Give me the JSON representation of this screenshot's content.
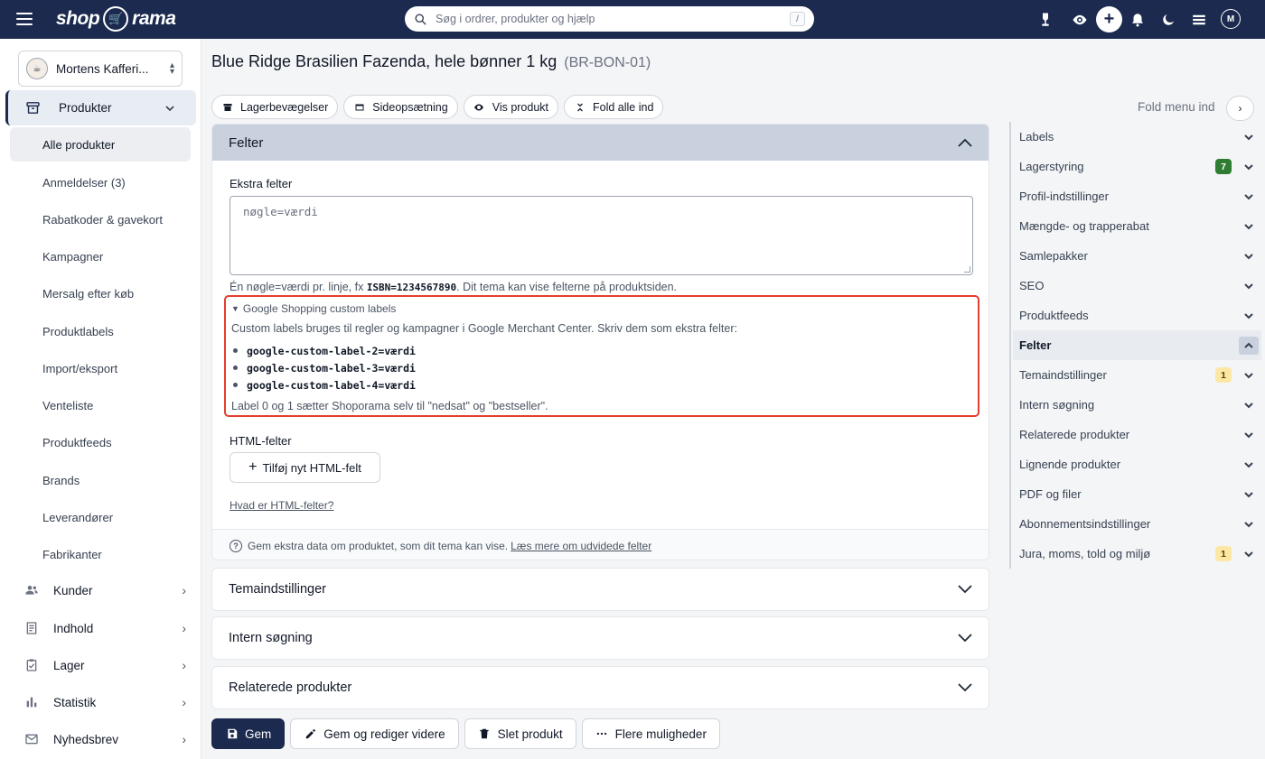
{
  "topbar": {
    "logo_left": "shop",
    "logo_right": "rama",
    "search_placeholder": "Søg i ordrer, produkter og hjælp",
    "search_shortcut": "/",
    "avatar_initial": "M"
  },
  "sidebar": {
    "shop_name": "Mortens Kafferi...",
    "products_label": "Produkter",
    "sub_items": [
      {
        "label": "Alle produkter"
      },
      {
        "label": "Anmeldelser (3)"
      },
      {
        "label": "Rabatkoder & gavekort"
      },
      {
        "label": "Kampagner"
      },
      {
        "label": "Mersalg efter køb"
      },
      {
        "label": "Produktlabels"
      },
      {
        "label": "Import/eksport"
      },
      {
        "label": "Venteliste"
      },
      {
        "label": "Produktfeeds"
      },
      {
        "label": "Brands"
      },
      {
        "label": "Leverandører"
      },
      {
        "label": "Fabrikanter"
      }
    ],
    "main_items": [
      {
        "label": "Kunder",
        "icon": "users-icon"
      },
      {
        "label": "Indhold",
        "icon": "document-icon"
      },
      {
        "label": "Lager",
        "icon": "clipboard-check-icon"
      },
      {
        "label": "Statistik",
        "icon": "bar-chart-icon"
      },
      {
        "label": "Nyhedsbrev",
        "icon": "mail-icon"
      }
    ]
  },
  "page": {
    "title": "Blue Ridge Brasilien Fazenda, hele bønner 1 kg",
    "sku": "(BR-BON-01)"
  },
  "actions": {
    "stock_moves": "Lagerbevægelser",
    "page_setup": "Sideopsætning",
    "view_product": "Vis produkt",
    "fold_all": "Fold alle ind"
  },
  "felter": {
    "title": "Felter",
    "extra_label": "Ekstra felter",
    "extra_placeholder": "nøgle=værdi",
    "help_pre": "Én nøgle=værdi pr. linje, fx ",
    "help_code": "ISBN=1234567890",
    "help_post": ". Dit tema kan vise felterne på produktsiden.",
    "gs_summary": "Google Shopping custom labels",
    "gs_desc": "Custom labels bruges til regler og kampagner i Google Merchant Center. Skriv dem som ekstra felter:",
    "gs_items": [
      "google-custom-label-2=værdi",
      "google-custom-label-3=værdi",
      "google-custom-label-4=værdi"
    ],
    "gs_note": "Label 0 og 1 sætter Shoporama selv til \"nedsat\" og \"bestseller\".",
    "html_label": "HTML-felter",
    "add_html": "Tilføj nyt HTML-felt",
    "what_html": "Hvad er HTML-felter?",
    "footer_text": "Gem ekstra data om produktet, som dit tema kan vise.",
    "footer_link": "Læs mere om udvidede felter"
  },
  "collapsed_sections": [
    {
      "title": "Temaindstillinger"
    },
    {
      "title": "Intern søgning"
    },
    {
      "title": "Relaterede produkter"
    }
  ],
  "bottom": {
    "save": "Gem",
    "save_continue": "Gem og rediger videre",
    "delete": "Slet produkt",
    "more": "Flere muligheder"
  },
  "right_panel": {
    "fold_menu": "Fold menu ind",
    "items": [
      {
        "label": "Labels",
        "badge": ""
      },
      {
        "label": "Lagerstyring",
        "badge": "7"
      },
      {
        "label": "Profil-indstillinger",
        "badge": ""
      },
      {
        "label": "Mængde- og trapperabat",
        "badge": ""
      },
      {
        "label": "Samlepakker",
        "badge": ""
      },
      {
        "label": "SEO",
        "badge": ""
      },
      {
        "label": "Produktfeeds",
        "badge": ""
      },
      {
        "label": "Felter",
        "badge": ""
      },
      {
        "label": "Temaindstillinger",
        "badge": "1"
      },
      {
        "label": "Intern søgning",
        "badge": ""
      },
      {
        "label": "Relaterede produkter",
        "badge": ""
      },
      {
        "label": "Lignende produkter",
        "badge": ""
      },
      {
        "label": "PDF og filer",
        "badge": ""
      },
      {
        "label": "Abonnementsindstillinger",
        "badge": ""
      },
      {
        "label": "Jura, moms, told og miljø",
        "badge": "1"
      }
    ]
  },
  "colors": {
    "navy": "#1b2a4e",
    "highlight_red": "#e53e2e",
    "badge_green": "#2e7d32",
    "badge_yellow": "#fde7a4"
  }
}
